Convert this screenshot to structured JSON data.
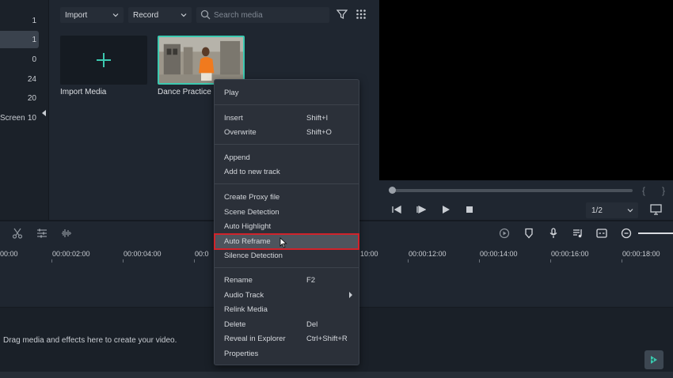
{
  "left_panel": {
    "items": [
      {
        "name": "",
        "count": "1"
      },
      {
        "name": "",
        "count": "1"
      },
      {
        "name": "",
        "count": "0"
      },
      {
        "name": "",
        "count": "24"
      },
      {
        "name": "",
        "count": "20"
      },
      {
        "name": "Screen",
        "count": "10"
      }
    ]
  },
  "toolbar": {
    "import_label": "Import",
    "record_label": "Record",
    "search_placeholder": "Search media"
  },
  "media": {
    "tiles": [
      {
        "label": "Import Media"
      },
      {
        "label": "Dance Practice"
      }
    ]
  },
  "preview": {
    "ratio": "1/2",
    "brace_left": "{",
    "brace_right": "}"
  },
  "ruler": {
    "labels": [
      "00:00",
      "00:00:02:00",
      "00:00:04:00",
      "00:0",
      "10:00",
      "00:00:12:00",
      "00:00:14:00",
      "00:00:16:00",
      "00:00:18:00"
    ]
  },
  "timeline": {
    "drop_hint": "Drag media and effects here to create your video."
  },
  "context_menu": {
    "items": [
      {
        "label": "Play",
        "shortcut": ""
      },
      {
        "label": "Insert",
        "shortcut": "Shift+I"
      },
      {
        "label": "Overwrite",
        "shortcut": "Shift+O"
      },
      {
        "label": "Append",
        "shortcut": ""
      },
      {
        "label": "Add to new track",
        "shortcut": ""
      },
      {
        "label": "Create Proxy file",
        "shortcut": ""
      },
      {
        "label": "Scene Detection",
        "shortcut": ""
      },
      {
        "label": "Auto Highlight",
        "shortcut": ""
      },
      {
        "label": "Auto Reframe",
        "shortcut": ""
      },
      {
        "label": "Silence Detection",
        "shortcut": ""
      },
      {
        "label": "Rename",
        "shortcut": "F2"
      },
      {
        "label": "Audio Track",
        "shortcut": ""
      },
      {
        "label": "Relink Media",
        "shortcut": ""
      },
      {
        "label": "Delete",
        "shortcut": "Del"
      },
      {
        "label": "Reveal in Explorer",
        "shortcut": "Ctrl+Shift+R"
      },
      {
        "label": "Properties",
        "shortcut": ""
      }
    ],
    "highlighted": "Auto Reframe"
  },
  "colors": {
    "accent": "#3cc9b0",
    "highlight_border": "#d0232b",
    "background": "#1f2630"
  }
}
